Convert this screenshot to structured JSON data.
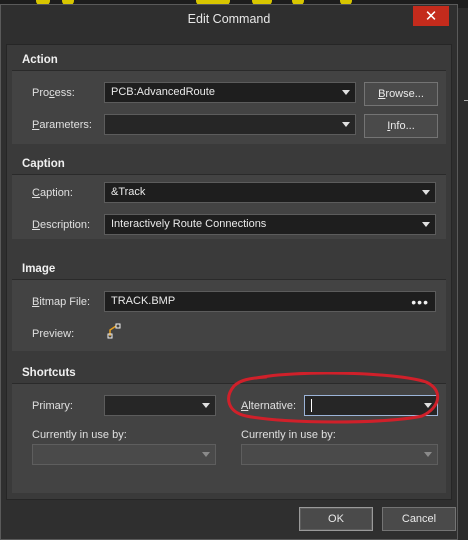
{
  "dialog": {
    "title": "Edit Command",
    "close_glyph": "✕"
  },
  "action": {
    "header": "Action",
    "process_label_pre": "Pro",
    "process_label_ul": "c",
    "process_label_post": "ess:",
    "process_value": "PCB:AdvancedRoute",
    "parameters_label_ul": "P",
    "parameters_label_post": "arameters:",
    "parameters_value": "",
    "browse_label_ul": "B",
    "browse_label_post": "rowse...",
    "info_label_ul": "I",
    "info_label_post": "nfo..."
  },
  "caption": {
    "header": "Caption",
    "caption_label_ul": "C",
    "caption_label_post": "aption:",
    "caption_value": "&Track",
    "description_label_ul": "D",
    "description_label_post": "escription:",
    "description_value": "Interactively Route Connections"
  },
  "image": {
    "header": "Image",
    "bitmap_label_ul": "B",
    "bitmap_label_post": "itmap File:",
    "bitmap_value": "TRACK.BMP",
    "bitmap_button": "•••",
    "preview_label": "Preview:",
    "preview_icon": "track-route-icon"
  },
  "shortcuts": {
    "header": "Shortcuts",
    "primary_label": "Primary:",
    "primary_value": "",
    "alternative_label_ul": "A",
    "alternative_label_post": "lternative:",
    "alternative_value": "",
    "currently_in_use_left": "Currently in use by:",
    "currently_in_use_right": "Currently in use by:",
    "in_use_left_value": "",
    "in_use_right_value": ""
  },
  "footer": {
    "ok_label": "OK",
    "cancel_label": "Cancel"
  },
  "colors": {
    "annotation": "#d0202a",
    "close_button": "#c42b1c",
    "background_highlight": "#d8c600"
  }
}
